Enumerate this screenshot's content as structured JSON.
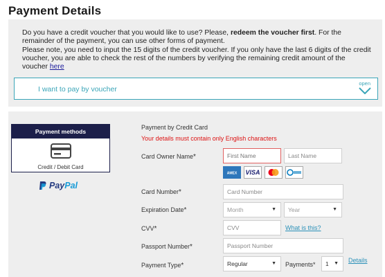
{
  "page_title": "Payment Details",
  "voucher": {
    "text_q": "Do you have a credit voucher that you would like to use? Please, ",
    "text_bold": "redeem the voucher first",
    "text_rest": ". For the remainder of the payment, you can use other forms of payment.",
    "text_note": "Please note, you need to input the 15 digits of the credit voucher. If you only have the last 6 digits of the credit voucher, you are able to check the rest of the numbers by verifying the remaining credit amount of the voucher ",
    "link_here": "here",
    "toggle_label": "I want to pay by voucher",
    "toggle_open": "open"
  },
  "methods": {
    "header": "Payment methods",
    "card_label": "Credit / Debit Card",
    "paypal_pay": "Pay",
    "paypal_pal": "Pal"
  },
  "form": {
    "heading": "Payment by Credit Card",
    "warning": "Your details must contain only English characters",
    "owner_label": "Card Owner Name",
    "first_placeholder": "First Name",
    "last_placeholder": "Last Name",
    "card_number_label": "Card Number",
    "card_number_placeholder": "Card Number",
    "expiration_label": "Expiration Date",
    "month_placeholder": "Month",
    "year_placeholder": "Year",
    "cvv_label": "CVV",
    "cvv_placeholder": "CVV",
    "what_is_this": "What is this?",
    "passport_label": "Passport Number",
    "passport_placeholder": "Passport Number",
    "payment_type_label": "Payment Type",
    "payment_type_value": "Regular",
    "payments_label": "Payments",
    "payments_value": "1",
    "details_link": "Details",
    "required_mark": "*"
  },
  "card_brands": [
    "AMEX",
    "VISA",
    "MC",
    "DINERS"
  ],
  "colors": {
    "accent": "#3aa5b8",
    "nav_dark": "#1c1f4a",
    "error": "#d11111",
    "link": "#2a90b8"
  }
}
